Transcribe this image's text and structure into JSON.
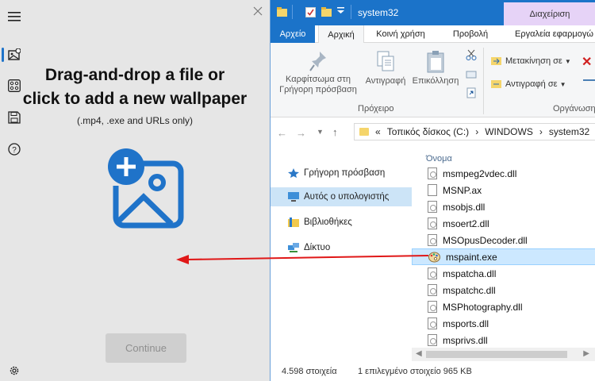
{
  "app": {
    "drop_title_line1": "Drag-and-drop a file or",
    "drop_title_line2": "click to add a new wallpaper",
    "drop_subtitle": "(.mp4, .exe and URLs only)",
    "continue_label": "Continue",
    "accent": "#1f73c9"
  },
  "explorer": {
    "title": "system32",
    "manage_tab": "Διαχείριση",
    "tabs": [
      "Αρχείο",
      "Αρχική",
      "Κοινή χρήση",
      "Προβολή",
      "Εργαλεία εφαρμογώ"
    ],
    "ribbon": {
      "pin_label_line1": "Καρφίτσωμα στη",
      "pin_label_line2": "Γρήγορη πρόσβαση",
      "copy_label": "Αντιγραφή",
      "paste_label": "Επικόλληση",
      "clipboard_group": "Πρόχειρο",
      "move_to": "Μετακίνηση σε",
      "copy_to": "Αντιγραφή σε",
      "organize_group": "Οργάνωση"
    },
    "address": {
      "prefix": "«",
      "crumbs": [
        "Τοπικός δίσκος (C:)",
        "WINDOWS",
        "system32"
      ],
      "sep": "›"
    },
    "nav": [
      {
        "label": "Γρήγορη πρόσβαση",
        "icon": "star-icon"
      },
      {
        "label": "Αυτός ο υπολογιστής",
        "icon": "computer-icon"
      },
      {
        "label": "Βιβλιοθήκες",
        "icon": "library-icon"
      },
      {
        "label": "Δίκτυο",
        "icon": "network-icon"
      }
    ],
    "column_header": "Όνομα",
    "files": [
      "msmpeg2vdec.dll",
      "MSNP.ax",
      "msobjs.dll",
      "msoert2.dll",
      "MSOpusDecoder.dll",
      "mspaint.exe",
      "mspatcha.dll",
      "mspatchc.dll",
      "MSPhotography.dll",
      "msports.dll",
      "msprivs.dll"
    ],
    "selected_file": "mspaint.exe",
    "status": {
      "count": "4.598 στοιχεία",
      "selection": "1 επιλεγμένο στοιχείο  965 KB"
    }
  }
}
